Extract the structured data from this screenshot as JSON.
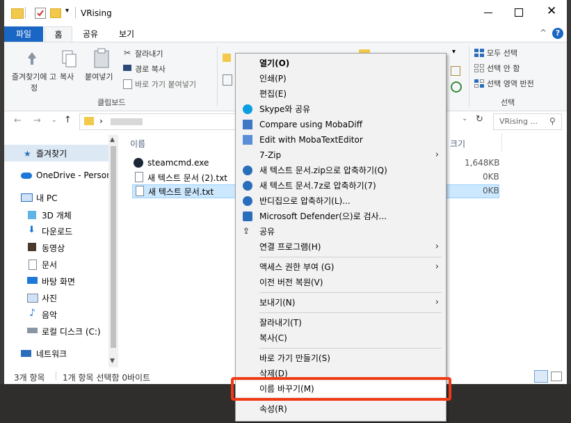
{
  "window": {
    "title": "VRising"
  },
  "ribbon": {
    "tabs": [
      "파일",
      "홈",
      "공유",
      "보기"
    ],
    "clipboard": {
      "pin_label": "즐겨찾기에 고정",
      "copy_label": "복사",
      "paste_label": "붙여넣기",
      "cut_label": "잘라내기",
      "copy_path_label": "경로 복사",
      "paste_shortcut_label": "바로 가기 붙여넣기",
      "group_label": "클립보드"
    },
    "select": {
      "select_all": "모두 선택",
      "select_none": "선택 안 함",
      "invert_selection": "선택 영역 반전",
      "group_label": "선택"
    }
  },
  "address": {
    "separator": "›",
    "search_placeholder": "VRising ..."
  },
  "nav": {
    "items": [
      {
        "label": "즐겨찾기",
        "icon": "star-icon"
      },
      {
        "label": "OneDrive - Person",
        "icon": "cloud-icon"
      },
      {
        "label": "내 PC",
        "icon": "pc-icon"
      },
      {
        "label": "3D 개체",
        "icon": "cube-icon"
      },
      {
        "label": "다운로드",
        "icon": "download-icon"
      },
      {
        "label": "동영상",
        "icon": "video-icon"
      },
      {
        "label": "문서",
        "icon": "document-icon"
      },
      {
        "label": "바탕 화면",
        "icon": "desktop-icon"
      },
      {
        "label": "사진",
        "icon": "picture-icon"
      },
      {
        "label": "음악",
        "icon": "music-icon"
      },
      {
        "label": "로컬 디스크 (C:)",
        "icon": "disk-icon"
      },
      {
        "label": "네트워크",
        "icon": "network-icon"
      }
    ]
  },
  "content": {
    "col_name": "이름",
    "col_size": "크기",
    "files": [
      {
        "name": "steamcmd.exe",
        "size": "1,648KB"
      },
      {
        "name": "새 텍스트 문서 (2).txt",
        "size": "0KB"
      },
      {
        "name": "새 텍스트 문서.txt",
        "size": "0KB"
      }
    ]
  },
  "status": {
    "count": "3개 항목",
    "selected": "1개 항목 선택함 0바이트"
  },
  "context_menu": {
    "items": [
      {
        "label": "열기(O)",
        "bold": true
      },
      {
        "label": "인쇄(P)"
      },
      {
        "label": "편집(E)"
      },
      {
        "label": "Skype와 공유",
        "icon": "skype-icon"
      },
      {
        "label": "Compare using MobaDiff",
        "icon": "mobadiff-icon"
      },
      {
        "label": "Edit with MobaTextEditor",
        "icon": "mobatexteditor-icon"
      },
      {
        "label": "7-Zip",
        "submenu": true
      },
      {
        "label": "새 텍스트 문서.zip으로 압축하기(Q)",
        "icon": "bandizip-icon"
      },
      {
        "label": "새 텍스트 문서.7z로 압축하기(7)",
        "icon": "bandizip-icon"
      },
      {
        "label": "반디집으로 압축하기(L)...",
        "icon": "bandizip-icon"
      },
      {
        "label": "Microsoft Defender(으)로 검사...",
        "icon": "defender-icon"
      },
      {
        "label": "공유",
        "icon": "share-icon"
      },
      {
        "label": "연결 프로그램(H)",
        "submenu": true
      },
      {
        "label": "액세스 권한 부여 (G)",
        "submenu": true
      },
      {
        "label": "이전 버전 복원(V)"
      },
      {
        "label": "보내기(N)",
        "submenu": true
      },
      {
        "label": "잘라내기(T)"
      },
      {
        "label": "복사(C)"
      },
      {
        "label": "바로 가기 만들기(S)"
      },
      {
        "label": "삭제(D)"
      },
      {
        "label": "이름 바꾸기(M)"
      },
      {
        "label": "속성(R)"
      }
    ]
  }
}
